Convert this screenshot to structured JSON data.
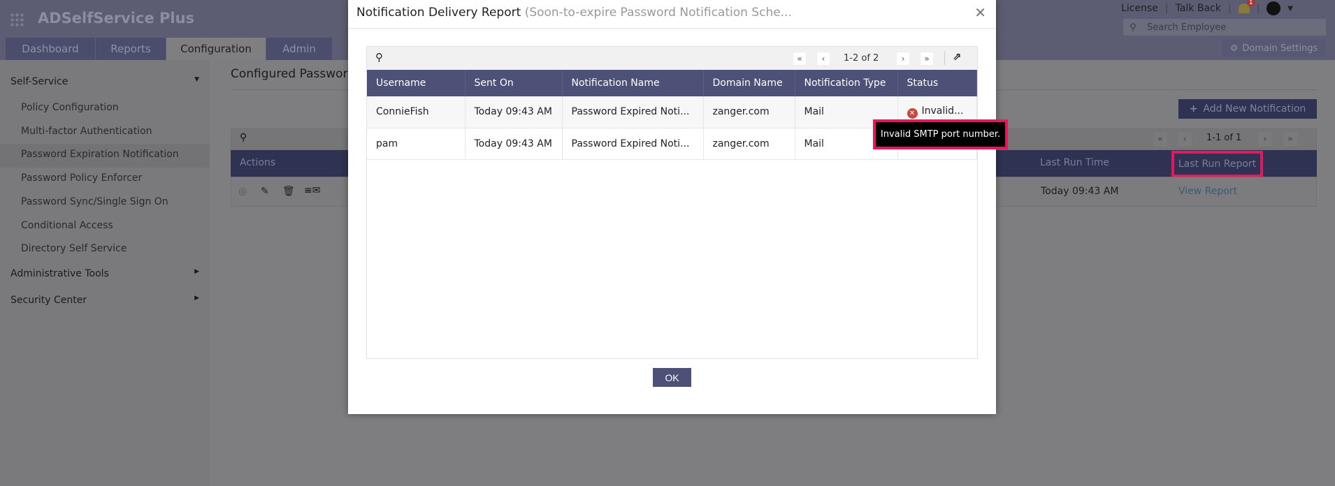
{
  "app": {
    "name": "ADSelfService Plus"
  },
  "tabs": [
    "Dashboard",
    "Reports",
    "Configuration",
    "Admin"
  ],
  "top": {
    "license": "License",
    "talk_back": "Talk Back",
    "notif_count": "1",
    "search_placeholder": "Search Employee",
    "domain_settings": "Domain Settings"
  },
  "sidebar": {
    "self_service": "Self-Service",
    "items": [
      "Policy Configuration",
      "Multi-factor Authentication",
      "Password Expiration Notification",
      "Password Policy Enforcer",
      "Password Sync/Single Sign On",
      "Conditional Access",
      "Directory Self Service"
    ],
    "admin_tools": "Administrative Tools",
    "security_center": "Security Center"
  },
  "page": {
    "title": "Configured Password/",
    "add_button": "Add New Notification",
    "pagination": "1-1 of 1",
    "columns": {
      "actions": "Actions",
      "last_run_time": "Last Run Time",
      "last_run_report": "Last Run Report"
    },
    "row": {
      "last_run_time": "Today 09:43 AM",
      "view_report": "View Report"
    }
  },
  "dialog": {
    "title": "Notification Delivery Report",
    "subtitle": "(Soon-to-expire Password Notification Sche...",
    "pagination": "1-2 of 2",
    "columns": [
      "Username",
      "Sent On",
      "Notification Name",
      "Domain Name",
      "Notification Type",
      "Status"
    ],
    "rows": [
      [
        "ConnieFish",
        "Today 09:43 AM",
        "Password Expired Noti...",
        "zanger.com",
        "Mail",
        "Invalid..."
      ],
      [
        "pam",
        "Today 09:43 AM",
        "Password Expired Noti...",
        "zanger.com",
        "Mail",
        ""
      ]
    ],
    "tooltip": "Invalid SMTP port number.",
    "ok": "OK"
  },
  "colors": {
    "highlight": "#e8175d",
    "header": "#4d5077"
  }
}
